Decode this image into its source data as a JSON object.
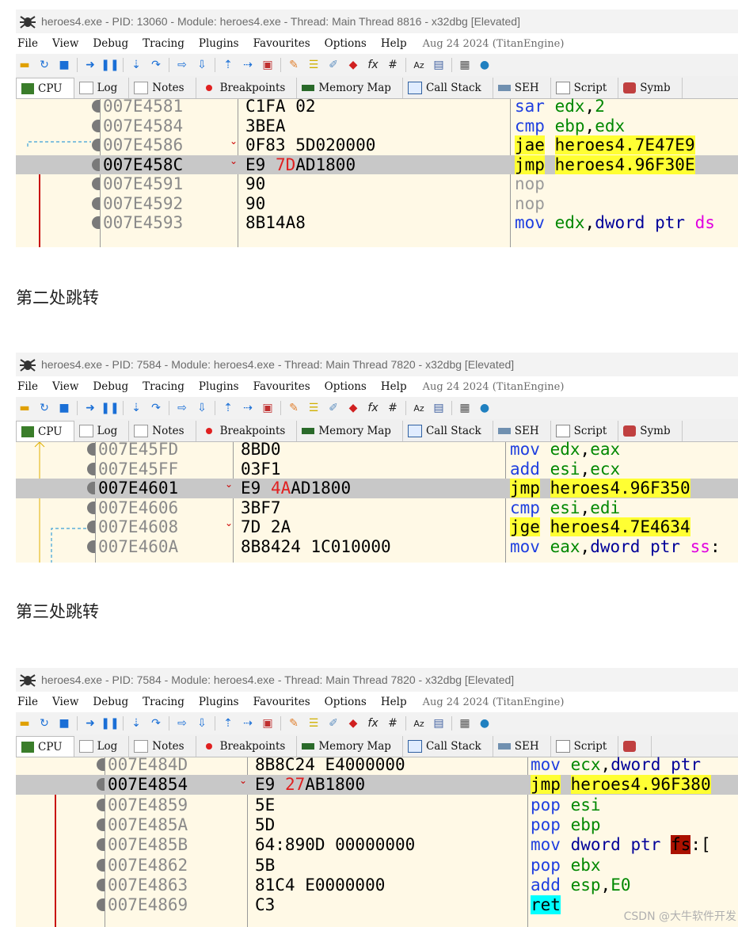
{
  "toolbar_icons": [
    "open-icon",
    "restart-icon",
    "stop-icon",
    "run-icon",
    "pause-icon",
    "step-into-icon",
    "step-over-icon",
    "trace-into-icon",
    "trace-over-icon",
    "execute-till-return-icon",
    "run-to-user-code-icon",
    "script-icon",
    "patch-icon",
    "comment-icon",
    "label-icon",
    "bookmark-icon",
    "function-icon",
    "hash-icon",
    "font-icon",
    "memory-icon",
    "calculator-icon",
    "globe-icon"
  ],
  "menu": [
    "File",
    "View",
    "Debug",
    "Tracing",
    "Plugins",
    "Favourites",
    "Options",
    "Help"
  ],
  "tabs": [
    "CPU",
    "Log",
    "Notes",
    "Breakpoints",
    "Memory Map",
    "Call Stack",
    "SEH",
    "Script",
    "Symb"
  ],
  "headings": {
    "second": "第二处跳转",
    "third": "第三处跳转"
  },
  "watermark": "CSDN @大牛软件开发",
  "shots": [
    {
      "title": "heroes4.exe - PID: 13060 - Module: heroes4.exe - Thread: Main Thread 8816 - x32dbg [Elevated]",
      "date": "Aug 24 2024 (TitanEngine)",
      "rows": [
        {
          "addr": "007E4581",
          "bytes": "C1FA 02",
          "m": "sar",
          "ops": "edx,2"
        },
        {
          "addr": "007E4584",
          "bytes": "3BEA",
          "m": "cmp",
          "ops": "ebp,edx"
        },
        {
          "addr": "007E4586",
          "bytes": "0F83 5D020000",
          "m": "jae",
          "ops": "heroes4.7E47E9"
        },
        {
          "addr": "007E458C",
          "bytes_red": "7D",
          "bytes_pre": "E9 ",
          "bytes_post": "AD1800",
          "m": "jmp",
          "ops": "heroes4.96F30E"
        },
        {
          "addr": "007E4591",
          "bytes": "90",
          "m": "nop",
          "ops": ""
        },
        {
          "addr": "007E4592",
          "bytes": "90",
          "m": "nop",
          "ops": ""
        },
        {
          "addr": "007E4593",
          "bytes": "8B14A8",
          "m": "mov",
          "ops": "edx,dword ptr ds"
        }
      ]
    },
    {
      "title": "heroes4.exe - PID: 7584 - Module: heroes4.exe - Thread: Main Thread 7820 - x32dbg [Elevated]",
      "date": "Aug 24 2024 (TitanEngine)",
      "rows": [
        {
          "addr": "007E45FD",
          "bytes": "8BD0",
          "m": "mov",
          "ops": "edx,eax"
        },
        {
          "addr": "007E45FF",
          "bytes": "03F1",
          "m": "add",
          "ops": "esi,ecx"
        },
        {
          "addr": "007E4601",
          "bytes_red": "4A",
          "bytes_pre": "E9 ",
          "bytes_post": "AD1800",
          "m": "jmp",
          "ops": "heroes4.96F350"
        },
        {
          "addr": "007E4606",
          "bytes": "3BF7",
          "m": "cmp",
          "ops": "esi,edi"
        },
        {
          "addr": "007E4608",
          "bytes": "7D 2A",
          "m": "jge",
          "ops": "heroes4.7E4634"
        },
        {
          "addr": "007E460A",
          "bytes": "8B8424 1C010000",
          "m": "mov",
          "ops": "eax,dword ptr ss:"
        }
      ]
    },
    {
      "title": "heroes4.exe - PID: 7584 - Module: heroes4.exe - Thread: Main Thread 7820 - x32dbg [Elevated]",
      "date": "Aug 24 2024 (TitanEngine)",
      "rows": [
        {
          "addr": "007E484D",
          "bytes": "8B8C24 E4000000",
          "m": "mov",
          "ops": "ecx,dword ptr"
        },
        {
          "addr": "007E4854",
          "bytes_red": "27",
          "bytes_pre": "E9 ",
          "bytes_post": "AB1800",
          "m": "jmp",
          "ops": "heroes4.96F380"
        },
        {
          "addr": "007E4859",
          "bytes": "5E",
          "m": "pop",
          "ops": "esi"
        },
        {
          "addr": "007E485A",
          "bytes": "5D",
          "m": "pop",
          "ops": "ebp"
        },
        {
          "addr": "007E485B",
          "bytes": "64:890D 00000000",
          "m": "mov",
          "ops": "dword ptr fs:["
        },
        {
          "addr": "007E4862",
          "bytes": "5B",
          "m": "pop",
          "ops": "ebx"
        },
        {
          "addr": "007E4863",
          "bytes": "81C4 E0000000",
          "m": "add",
          "ops": "esp,E0"
        },
        {
          "addr": "007E4869",
          "bytes": "C3",
          "m": "ret",
          "ops": ""
        }
      ]
    }
  ]
}
